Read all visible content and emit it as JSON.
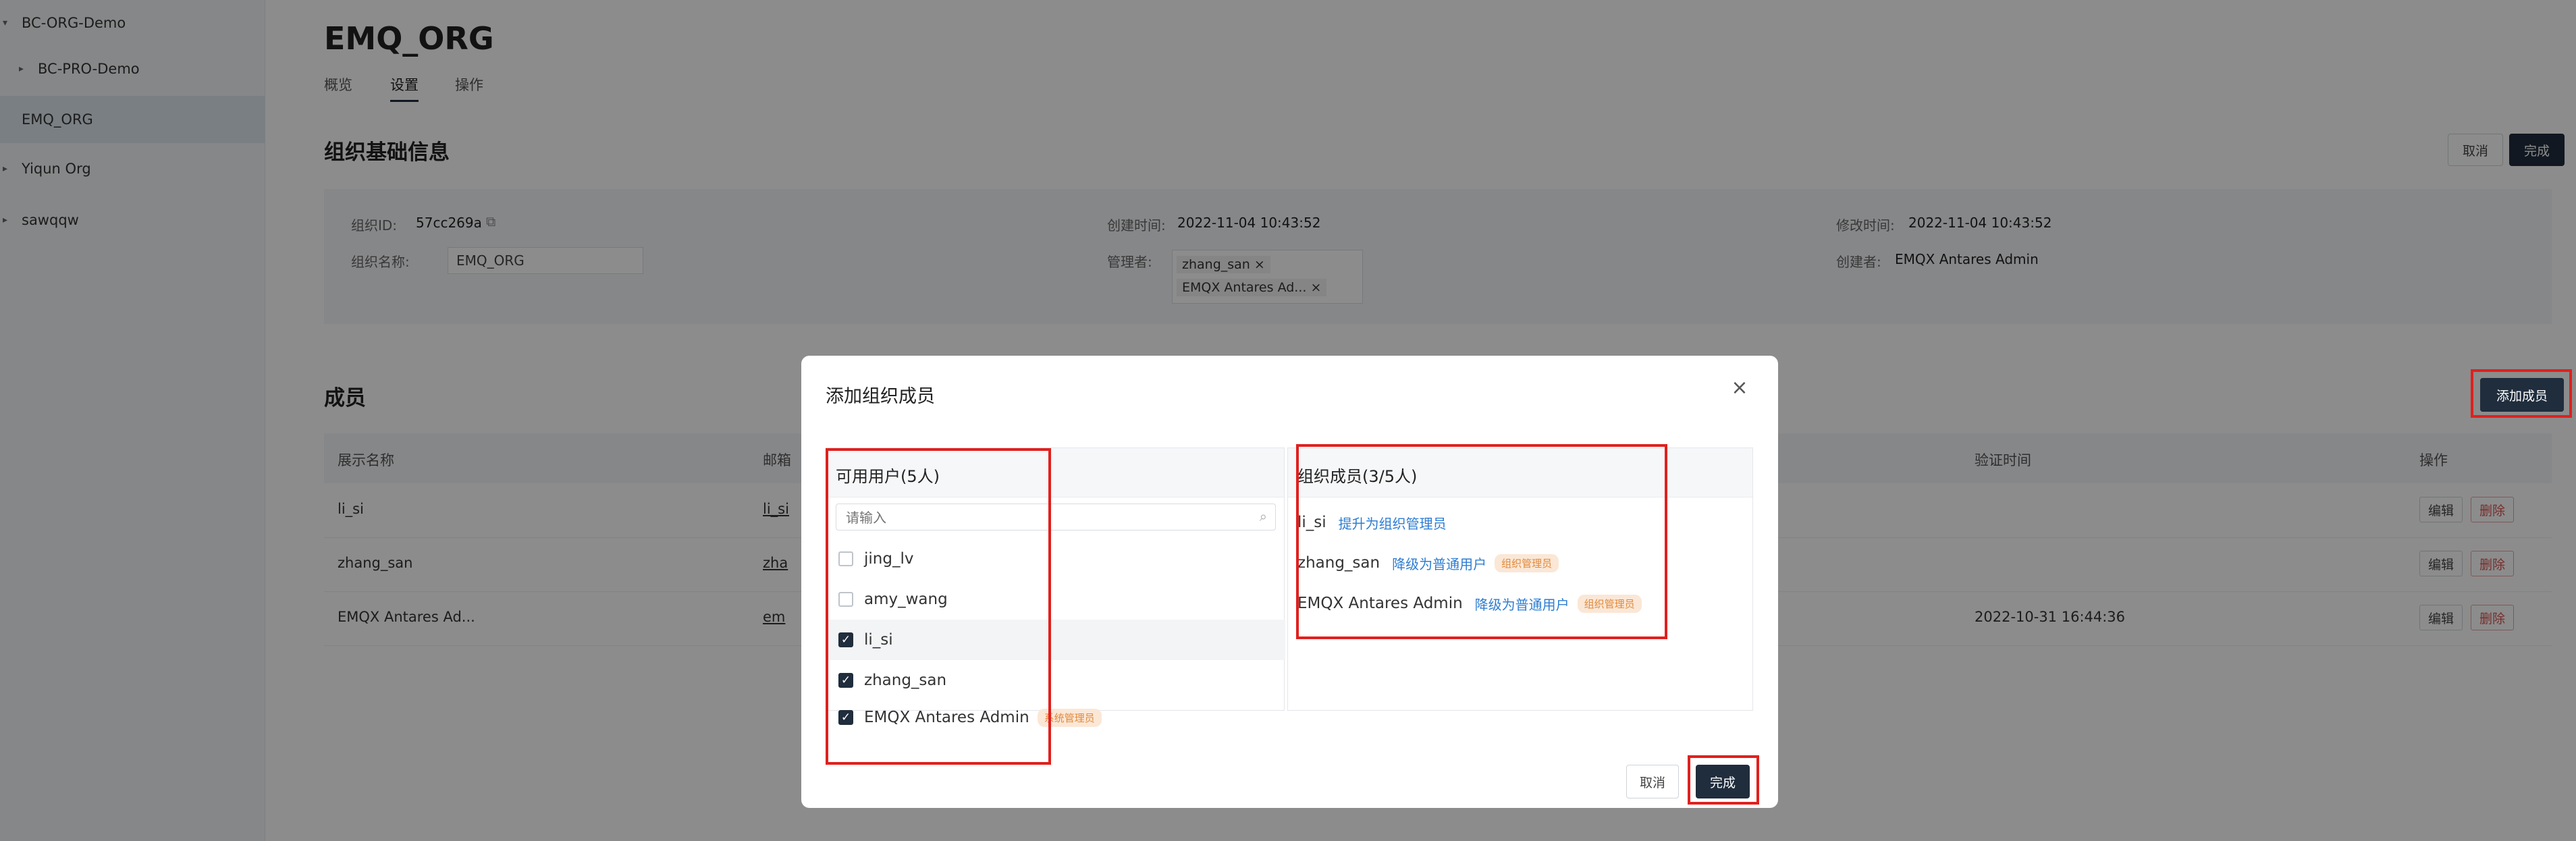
{
  "sidebar": {
    "items": [
      {
        "label": "BC-ORG-Demo",
        "expanded": true
      },
      {
        "label": "BC-PRO-Demo"
      },
      {
        "label": "EMQ_ORG",
        "selected": true
      },
      {
        "label": "Yiqun Org"
      },
      {
        "label": "sawqqw"
      }
    ]
  },
  "page": {
    "title": "EMQ_ORG",
    "tabs": [
      "概览",
      "设置",
      "操作"
    ],
    "active_tab": "设置"
  },
  "basic": {
    "title": "组织基础信息",
    "cancel": "取消",
    "done": "完成",
    "org_id_label": "组织ID:",
    "org_id": "57cc269a",
    "org_name_label": "组织名称:",
    "org_name": "EMQ_ORG",
    "created_label": "创建时间:",
    "created": "2022-11-04 10:43:52",
    "manager_label": "管理者:",
    "managers": [
      "zhang_san",
      "EMQX Antares Ad..."
    ],
    "modified_label": "修改时间:",
    "modified": "2022-11-04 10:43:52",
    "creator_label": "创建者:",
    "creator": "EMQX Antares Admin"
  },
  "members": {
    "title": "成员",
    "add_button": "添加成员",
    "columns": [
      "展示名称",
      "邮箱",
      "验证时间",
      "操作"
    ],
    "rows": [
      {
        "name": "li_si",
        "email": "li_si",
        "time": ""
      },
      {
        "name": "zhang_san",
        "email": "zha",
        "time": ""
      },
      {
        "name": "EMQX Antares Ad...",
        "email": "em",
        "time": "2022-10-31 16:44:36"
      }
    ],
    "edit": "编辑",
    "delete": "删除"
  },
  "modal": {
    "title": "添加组织成员",
    "left_title": "可用用户(5人)",
    "search_placeholder": "请输入",
    "users": [
      {
        "name": "jing_lv",
        "checked": false
      },
      {
        "name": "amy_wang",
        "checked": false
      },
      {
        "name": "li_si",
        "checked": true
      },
      {
        "name": "zhang_san",
        "checked": true
      },
      {
        "name": "EMQX Antares Admin",
        "checked": true,
        "badge": "系统管理员"
      }
    ],
    "right_title": "组织成员(3/5人)",
    "members": [
      {
        "name": "li_si",
        "action": "提升为组织管理员"
      },
      {
        "name": "zhang_san",
        "action": "降级为普通用户",
        "badge": "组织管理员"
      },
      {
        "name": "EMQX Antares Admin",
        "action": "降级为普通用户",
        "badge": "组织管理员"
      }
    ],
    "cancel": "取消",
    "done": "完成"
  },
  "colors": {
    "primary": "#1f2d3d",
    "highlight": "#e0201e",
    "link": "#2d7dd2",
    "badge_text": "#e08a3c",
    "badge_bg": "#fbe7d6"
  }
}
